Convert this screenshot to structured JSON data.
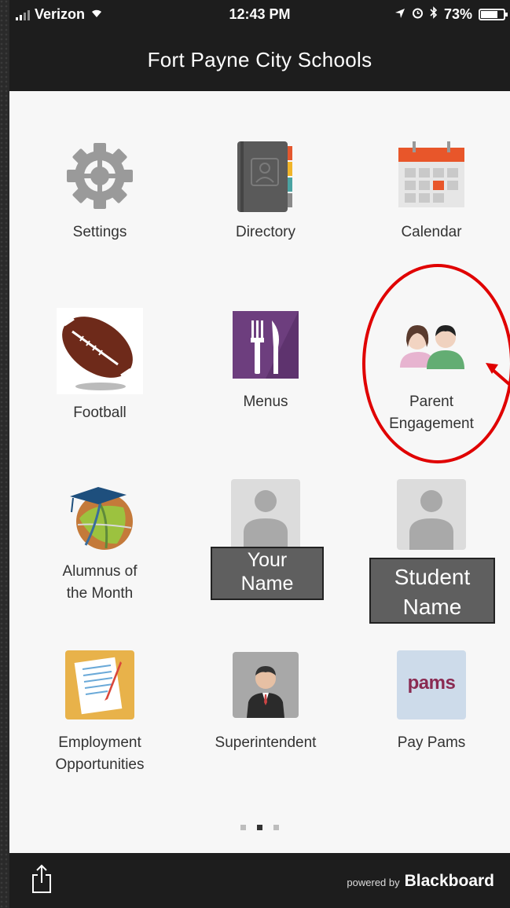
{
  "status": {
    "carrier": "Verizon",
    "time": "12:43 PM",
    "battery": "73%"
  },
  "header": {
    "title": "Fort Payne City Schools"
  },
  "tiles": [
    {
      "label": "Settings"
    },
    {
      "label": "Directory"
    },
    {
      "label": "Calendar"
    },
    {
      "label": "Football"
    },
    {
      "label": "Menus"
    },
    {
      "label": "Parent Engagement",
      "line1": "Parent",
      "line2": "Engagement"
    },
    {
      "label": "Alumnus of the Month",
      "line1": "Alumnus of",
      "line2": "the Month"
    },
    {
      "label": "Your Name"
    },
    {
      "label": "Student Name"
    },
    {
      "label": "Employment Opportunities",
      "line1": "Employment",
      "line2": "Opportunities"
    },
    {
      "label": "Superintendent"
    },
    {
      "label": "Pay Pams"
    }
  ],
  "overlays": {
    "your_name": {
      "line1": "Your",
      "line2": "Name"
    },
    "student_name": {
      "line1": "Student",
      "line2": "Name"
    }
  },
  "pams_logo_text": "pams",
  "footer": {
    "powered_by": "powered by",
    "brand": "Blackboard"
  },
  "page_indicator": {
    "count": 3,
    "active": 1
  },
  "colors": {
    "bar": "#1d1d1d",
    "highlight": "#e00000",
    "menus_purple": "#6d3e7e",
    "calendar_accent": "#e8562a"
  }
}
